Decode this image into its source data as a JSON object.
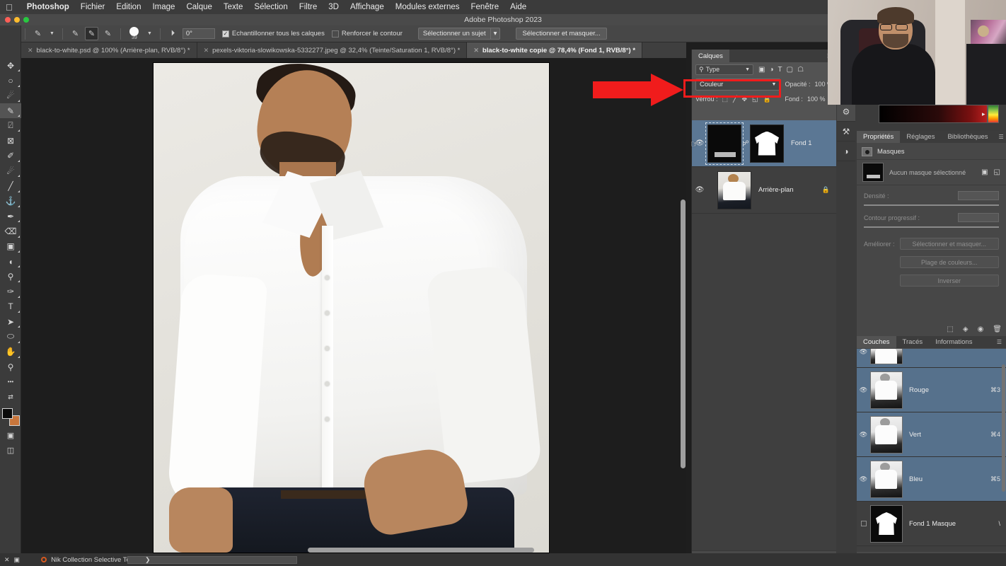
{
  "macmenu": {
    "apple_icon": "apple-icon",
    "items": [
      {
        "label": "Photoshop",
        "bold": true
      },
      {
        "label": "Fichier"
      },
      {
        "label": "Edition"
      },
      {
        "label": "Image"
      },
      {
        "label": "Calque"
      },
      {
        "label": "Texte"
      },
      {
        "label": "Sélection"
      },
      {
        "label": "Filtre"
      },
      {
        "label": "3D"
      },
      {
        "label": "Affichage"
      },
      {
        "label": "Modules externes"
      },
      {
        "label": "Fenêtre"
      },
      {
        "label": "Aide"
      }
    ],
    "status_icons": [
      {
        "name": "airplane-icon",
        "glyph": "✈"
      },
      {
        "name": "dropbox-icon",
        "glyph": "⊘"
      },
      {
        "name": "notification-badge-icon",
        "glyph": "⚙"
      },
      {
        "name": "screen-record-icon",
        "glyph": "▣"
      },
      {
        "name": "clipboard-sync-icon",
        "glyph": "⧉"
      },
      {
        "name": "battery-icon",
        "glyph": "▍"
      },
      {
        "name": "clock-icon",
        "glyph": "◴"
      },
      {
        "name": "search-binoculars-icon",
        "glyph": "⚇"
      },
      {
        "name": "panels-icon",
        "glyph": "▥"
      },
      {
        "name": "display-icon",
        "glyph": "☐"
      },
      {
        "name": "volume-icon",
        "glyph": "◂"
      },
      {
        "name": "siri-icon",
        "glyph": "◔"
      },
      {
        "name": "menu-extra-icon",
        "glyph": "▐"
      }
    ]
  },
  "window": {
    "title": "Adobe Photoshop 2023",
    "traffic_lights": [
      "#ff5f57",
      "#febc2e",
      "#28c840"
    ]
  },
  "options_bar": {
    "home_icon": "home-icon",
    "tool_preset_icon": "brush-preset-icon",
    "mode_buttons": [
      {
        "name": "new-selection-brush",
        "glyph": "✎",
        "selected": false
      },
      {
        "name": "add-to-selection-brush",
        "glyph": "✎",
        "selected": true
      },
      {
        "name": "subtract-from-selection-brush",
        "glyph": "✎",
        "selected": false
      }
    ],
    "brush_size": "39",
    "angle_icon": "angle-icon",
    "angle_value": "0°",
    "checkbox_sample_all": {
      "label": "Echantillonner tous les calques",
      "checked": true
    },
    "checkbox_enhance_edge": {
      "label": "Renforcer le contour",
      "checked": false
    },
    "select_subject_label": "Sélectionner un sujet",
    "select_and_mask_label": "Sélectionner et masquer..."
  },
  "tabs": [
    {
      "label": "black-to-white.psd @ 100% (Arrière-plan, RVB/8°) *",
      "active": false
    },
    {
      "label": "pexels-viktoria-slowikowska-5332277.jpeg @ 32,4% (Teinte/Saturation 1, RVB/8°) *",
      "active": false
    },
    {
      "label": "black-to-white copie @ 78,4% (Fond 1, RVB/8°) *",
      "active": true
    }
  ],
  "toolbar": {
    "tools": [
      {
        "name": "move-tool",
        "glyph": "✥",
        "selected": false
      },
      {
        "name": "elliptical-marquee-tool",
        "glyph": "○",
        "selected": false
      },
      {
        "name": "lasso-tool",
        "glyph": "☄",
        "selected": false
      },
      {
        "name": "selection-brush-tool",
        "glyph": "✎",
        "selected": true
      },
      {
        "name": "crop-tool",
        "glyph": "⍁",
        "selected": false
      },
      {
        "name": "frame-tool",
        "glyph": "⊠",
        "selected": false
      },
      {
        "name": "eyedropper-tool",
        "glyph": "✐",
        "selected": false
      },
      {
        "name": "spot-healing-brush-tool",
        "glyph": "☄",
        "selected": false
      },
      {
        "name": "brush-tool",
        "glyph": "╱",
        "selected": false
      },
      {
        "name": "clone-stamp-tool",
        "glyph": "⚓",
        "selected": false
      },
      {
        "name": "history-brush-tool",
        "glyph": "✒",
        "selected": false
      },
      {
        "name": "eraser-tool",
        "glyph": "⌫",
        "selected": false
      },
      {
        "name": "gradient-tool",
        "glyph": "▣",
        "selected": false
      },
      {
        "name": "blur-tool",
        "glyph": "◖",
        "selected": false
      },
      {
        "name": "dodge-tool",
        "glyph": "⚲",
        "selected": false
      },
      {
        "name": "pen-tool",
        "glyph": "✑",
        "selected": false
      },
      {
        "name": "type-tool",
        "glyph": "T",
        "selected": false
      },
      {
        "name": "path-selection-tool",
        "glyph": "➤",
        "selected": false
      },
      {
        "name": "ellipse-shape-tool",
        "glyph": "⬭",
        "selected": false
      },
      {
        "name": "hand-tool",
        "glyph": "✋",
        "selected": false
      },
      {
        "name": "zoom-tool",
        "glyph": "⚲",
        "selected": false
      },
      {
        "name": "edit-toolbar-tool",
        "glyph": "•••",
        "selected": false
      },
      {
        "name": "swap-colors-icon",
        "glyph": "⇄",
        "selected": false
      }
    ],
    "foreground_color": "#0a0a0a",
    "background_color": "#c8763c",
    "quickmask_icon": "quick-mask-icon",
    "screenmode_icon": "screen-mode-icon"
  },
  "annotation": {
    "arrow_name": "red-annotation-arrow",
    "arrow_color": "#f01c1c",
    "highlight_box_name": "red-highlight-box"
  },
  "layers_panel": {
    "tabs": [
      {
        "label": "Calques",
        "active": true
      }
    ],
    "menu_icon": "panel-menu-icon",
    "filter": {
      "search_icon": "search-icon",
      "kind_label": "Type",
      "icons": [
        {
          "name": "filter-pixel-icon",
          "glyph": "▣"
        },
        {
          "name": "filter-adjustment-icon",
          "glyph": "◑"
        },
        {
          "name": "filter-type-icon",
          "glyph": "T"
        },
        {
          "name": "filter-shape-icon",
          "glyph": "▢"
        },
        {
          "name": "filter-smart-object-icon",
          "glyph": "☖"
        }
      ]
    },
    "blend_mode": "Couleur",
    "opacity_label": "Opacité :",
    "opacity_value": "100 %",
    "lock_label": "Verrou :",
    "lock_icons": [
      {
        "name": "lock-transparent-pixels-icon",
        "glyph": "⬚"
      },
      {
        "name": "lock-image-pixels-icon",
        "glyph": "╱"
      },
      {
        "name": "lock-position-icon",
        "glyph": "✥"
      },
      {
        "name": "lock-artboard-nesting-icon",
        "glyph": "◱"
      },
      {
        "name": "lock-all-icon",
        "glyph": "ὑ2"
      }
    ],
    "fill_label": "Fond :",
    "fill_value": "100 %",
    "layers": [
      {
        "name": "Fond 1",
        "selected": true,
        "visible": true,
        "linked": true,
        "thumb_kind": "solid-color-adjustment",
        "mask_kind": "shirt-silhouette-mask",
        "locked": false
      },
      {
        "name": "Arrière-plan",
        "selected": false,
        "visible": true,
        "linked": false,
        "thumb_kind": "photo",
        "mask_kind": null,
        "locked": true
      }
    ],
    "footer_icons": [
      {
        "name": "link-layers-icon",
        "glyph": "∞"
      },
      {
        "name": "layer-effects-fx-icon",
        "glyph": "fx"
      },
      {
        "name": "add-layer-mask-icon",
        "glyph": "▣"
      },
      {
        "name": "new-adjustment-layer-icon",
        "glyph": "◑"
      },
      {
        "name": "new-group-icon",
        "glyph": "☐"
      },
      {
        "name": "new-layer-icon",
        "glyph": "⊞"
      },
      {
        "name": "delete-layer-icon",
        "glyph": "Ὕ1"
      }
    ]
  },
  "icon_rail": [
    {
      "name": "adjustments-panel-icon",
      "glyph": "⚙",
      "active": true
    },
    {
      "name": "history-panel-icon",
      "glyph": "⚒",
      "active": false
    },
    {
      "name": "color-panel-icon",
      "glyph": "◑",
      "active": false
    }
  ],
  "properties_panel": {
    "tabs": [
      {
        "label": "Propriétés",
        "active": true
      },
      {
        "label": "Réglages",
        "active": false
      },
      {
        "label": "Bibliothèques",
        "active": false
      }
    ],
    "menu_icon": "panel-menu-icon",
    "section_icon": "mask-icon",
    "section_label": "Masques",
    "mask_status": "Aucun masque sélectionné",
    "mask_action_icons": [
      {
        "name": "pixel-mask-icon",
        "glyph": "▣"
      },
      {
        "name": "vector-mask-icon",
        "glyph": "◱"
      }
    ],
    "density_label": "Densité :",
    "density_value": "",
    "feather_label": "Contour progressif :",
    "feather_value": "",
    "refine_label": "Améliorer :",
    "refine_buttons": [
      "Sélectionner et masquer...",
      "Plage de couleurs...",
      "Inverser"
    ],
    "footer_icons": [
      {
        "name": "load-selection-icon",
        "glyph": "⬚"
      },
      {
        "name": "apply-mask-icon",
        "glyph": "◈"
      },
      {
        "name": "toggle-mask-visibility-icon",
        "glyph": "◉"
      },
      {
        "name": "delete-mask-icon",
        "glyph": "Ὕ1"
      }
    ]
  },
  "channels_panel": {
    "tabs": [
      {
        "label": "Couches",
        "active": true
      },
      {
        "label": "Tracés",
        "active": false
      },
      {
        "label": "Informations",
        "active": false
      }
    ],
    "menu_icon": "panel-menu-icon",
    "channels": [
      {
        "name": "",
        "shortcut": "",
        "selected": true,
        "visible": true,
        "thumb_kind": "photo-partial",
        "partial": true
      },
      {
        "name": "Rouge",
        "shortcut": "⌘3",
        "selected": true,
        "visible": true,
        "thumb_kind": "grayscale-photo"
      },
      {
        "name": "Vert",
        "shortcut": "⌘4",
        "selected": true,
        "visible": true,
        "thumb_kind": "grayscale-photo"
      },
      {
        "name": "Bleu",
        "shortcut": "⌘5",
        "selected": true,
        "visible": true,
        "thumb_kind": "grayscale-photo"
      },
      {
        "name": "Fond 1 Masque",
        "shortcut": "\\",
        "selected": false,
        "visible": false,
        "thumb_kind": "shirt-mask"
      }
    ],
    "footer_icons": [
      {
        "name": "load-channel-as-selection-icon",
        "glyph": "⬚"
      },
      {
        "name": "save-selection-as-channel-icon",
        "glyph": "▣"
      },
      {
        "name": "new-channel-icon",
        "glyph": "⊞"
      },
      {
        "name": "delete-channel-icon",
        "glyph": "Ὕ1"
      }
    ]
  },
  "status_bar": {
    "icons": [
      {
        "name": "close-doc-icon",
        "glyph": "✕"
      },
      {
        "name": "document-icon",
        "glyph": "▣"
      }
    ],
    "plugin_status_icon": "nik-collection-icon",
    "plugin_status_text": "Nik Collection Selective Tool",
    "progress_caret": "❯"
  },
  "canvas": {
    "image_name": "man-in-white-shirt-photo",
    "vertical_scrollbar": "canvas-vertical-scrollbar",
    "horizontal_scrollbar": "canvas-horizontal-scrollbar"
  },
  "webcam": {
    "name": "webcam-overlay",
    "subject": "presenter"
  }
}
